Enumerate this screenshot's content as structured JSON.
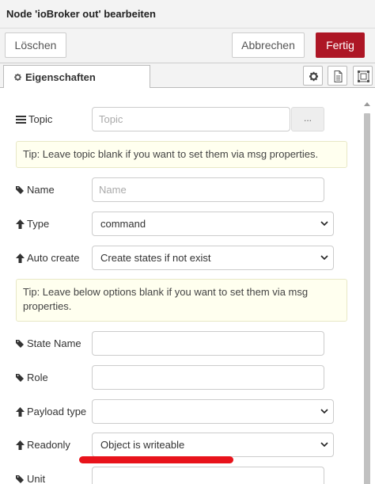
{
  "header": {
    "title": "Node 'ioBroker out' bearbeiten"
  },
  "toolbar": {
    "delete_label": "Löschen",
    "cancel_label": "Abbrechen",
    "done_label": "Fertig"
  },
  "tabs": {
    "properties_label": "Eigenschaften"
  },
  "colors": {
    "primary": "#ad1625",
    "tip_bg": "#ffffef",
    "annotation": "#e8131b"
  },
  "form": {
    "topic": {
      "label": "Topic",
      "placeholder": "Topic",
      "button_label": "..."
    },
    "tip1": "Tip: Leave topic blank if you want to set them via msg properties.",
    "name": {
      "label": "Name",
      "placeholder": "Name"
    },
    "type": {
      "label": "Type",
      "value": "command"
    },
    "auto_create": {
      "label": "Auto create",
      "value": "Create states if not exist"
    },
    "tip2": "Tip: Leave below options blank if you want to set them via msg properties.",
    "state_name": {
      "label": "State Name",
      "value": ""
    },
    "role": {
      "label": "Role",
      "value": ""
    },
    "payload_type": {
      "label": "Payload type",
      "value": ""
    },
    "readonly": {
      "label": "Readonly",
      "value": "Object is writeable"
    },
    "unit": {
      "label": "Unit",
      "value": ""
    }
  }
}
